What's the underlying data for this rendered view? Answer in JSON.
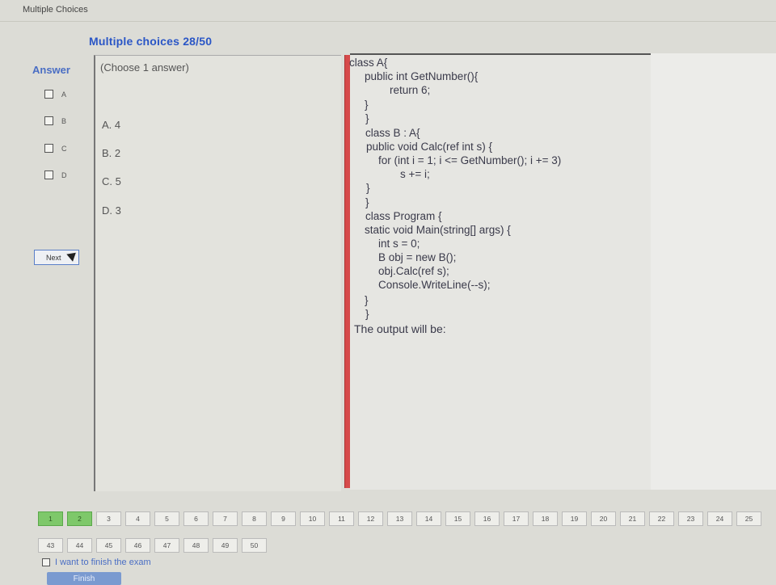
{
  "window": {
    "title": "Multiple Choices"
  },
  "header": {
    "title": "Multiple choices 28/50"
  },
  "answer_panel": {
    "heading": "Answer",
    "options": [
      "A",
      "B",
      "C",
      "D"
    ],
    "next_label": "Next"
  },
  "choices": {
    "instruction": "(Choose 1 answer)",
    "items": [
      "A. 4",
      "B. 2",
      "C. 5",
      "D. 3"
    ]
  },
  "question": {
    "code_lines": [
      "class A{",
      "    public int GetNumber(){",
      "        return 6;",
      "    }",
      "}",
      "class B : A{",
      "    public void Calc(ref int s) {",
      "        for (int i = 1; i <= GetNumber(); i += 3)",
      "            s += i;",
      "    }",
      "}",
      "class Program {",
      "    static void Main(string[] args) {",
      "        int s = 0;",
      "        B obj = new B();",
      "        obj.Calc(ref s);",
      "        Console.WriteLine(--s);",
      "    }",
      "}"
    ],
    "prompt": "The output will be:"
  },
  "navigation": {
    "row1": [
      "1",
      "2",
      "3",
      "4",
      "5",
      "6",
      "7",
      "8",
      "9",
      "10",
      "11",
      "12",
      "13",
      "14",
      "15",
      "16",
      "17",
      "18",
      "19",
      "20",
      "21",
      "22",
      "23",
      "24",
      "25"
    ],
    "row2": [
      "43",
      "44",
      "45",
      "46",
      "47",
      "48",
      "49",
      "50"
    ],
    "completed": [
      "1",
      "2"
    ]
  },
  "finish": {
    "checkbox_label": "I want to finish the exam",
    "button_label": "Finish"
  }
}
